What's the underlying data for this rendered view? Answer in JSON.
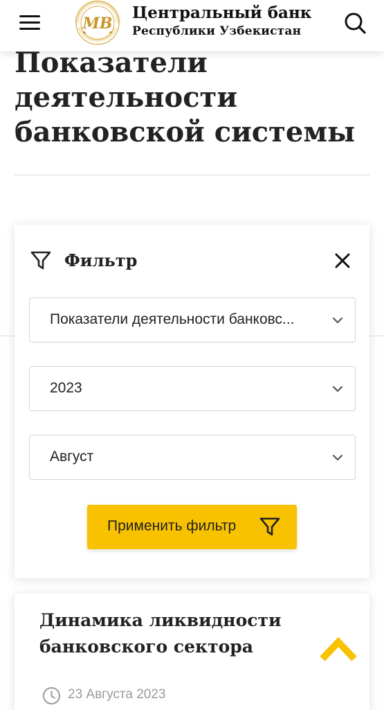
{
  "header": {
    "brand_title": "Центральный банк",
    "brand_subtitle": "Республики Узбекистан",
    "logo": {
      "monogram": "MB",
      "ring_text_top": "O'ZBEKISTON RESPUBLIKASI",
      "ring_text_bottom": "MARKAZIY BANKI"
    },
    "icons": {
      "menu": "hamburger-menu-icon",
      "search": "search-icon"
    }
  },
  "page": {
    "title": "Показатели деятельности банковской системы"
  },
  "filter": {
    "label": "Фильтр",
    "icons": {
      "filter": "funnel-icon",
      "close": "close-icon",
      "select": "chevron-down-icon"
    },
    "selects": {
      "report": "Показатели деятельности банковс...",
      "year": "2023",
      "month": "Август"
    },
    "apply_label": "Применить фильтр"
  },
  "news": {
    "title": "Динамика ликвидности банковского сектора",
    "date": "23 Августа 2023"
  },
  "colors": {
    "accent": "#f9c200",
    "logo_gold": "#c9962a",
    "text": "#222222",
    "muted": "#9a9a9a"
  }
}
